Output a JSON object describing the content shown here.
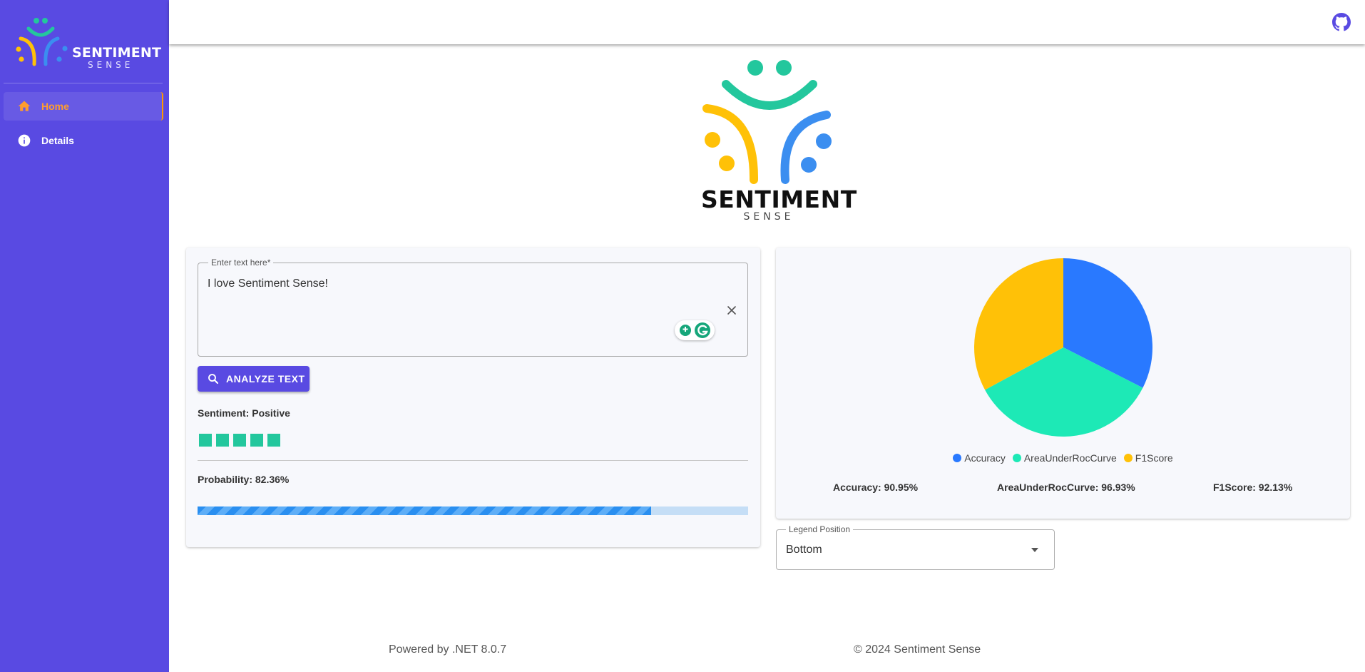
{
  "brand": {
    "title": "SENTIMENT",
    "subtitle": "SENSE"
  },
  "sidebar": {
    "items": [
      {
        "label": "Home",
        "icon": "home-icon",
        "active": true
      },
      {
        "label": "Details",
        "icon": "info-icon",
        "active": false
      }
    ]
  },
  "appbar": {
    "github_icon": "github-icon"
  },
  "analyzer": {
    "input_label": "Enter text here*",
    "input_value": "I love Sentiment Sense!",
    "button_label": "ANALYZE TEXT",
    "sentiment_text": "Sentiment: Positive",
    "rating": 5,
    "probability_text": "Probability: 82.36%",
    "probability": 0.8236
  },
  "chart_data": {
    "type": "pie",
    "categories": [
      "Accuracy",
      "AreaUnderRocCurve",
      "F1Score"
    ],
    "values": [
      90.95,
      96.93,
      92.13
    ],
    "colors": [
      "#2979ff",
      "#1de9b6",
      "#ffc107"
    ],
    "legend_position": "bottom",
    "metric_labels": [
      "Accuracy: 90.95%",
      "AreaUnderRocCurve: 96.93%",
      "F1Score: 92.13%"
    ]
  },
  "legend_select": {
    "label": "Legend Position",
    "value": "Bottom"
  },
  "footer": {
    "left": "Powered by .NET 8.0.7",
    "right": "© 2024 Sentiment Sense"
  },
  "colors": {
    "primary": "#594ae2",
    "active_nav": "#ff9800",
    "rating": "#23c79d",
    "progress": "#2a8ff0"
  }
}
